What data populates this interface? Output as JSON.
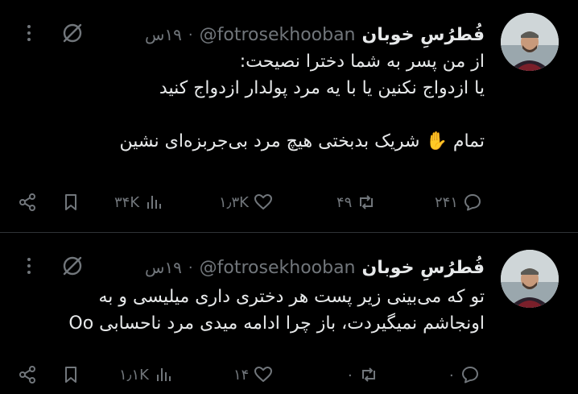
{
  "tweets": [
    {
      "author_name": "فُطرُسِ خوبان",
      "handle": "@fotrosekhooban",
      "separator": "·",
      "time": "۱۹س",
      "lines": [
        "از من پسر به شما دخترا نصیحت:",
        "یا ازدواج نکنین یا با یه مرد پولدار ازدواج کنید",
        "",
        "تمام ✋ شریک بدبختی هیچ مرد بی‌جربزه‌ای نشین"
      ],
      "replies": "۲۴۱",
      "reposts": "۴۹",
      "likes": "۱٫۳K",
      "views": "۳۴K"
    },
    {
      "author_name": "فُطرُسِ خوبان",
      "handle": "@fotrosekhooban",
      "separator": "·",
      "time": "۱۹س",
      "lines": [
        "تو که می‌بینی زیر پست هر دختری داری میلیسی و به",
        "اونجاشم نمیگیردت، باز چرا ادامه میدی مرد ناحسابی Oo"
      ],
      "replies": "۰",
      "reposts": "۰",
      "likes": "۱۴",
      "views": "۱٫۱K"
    }
  ],
  "icons": {
    "reply": "reply-icon",
    "repost": "repost-icon",
    "like": "heart-icon",
    "views": "views-chart-icon",
    "bookmark": "bookmark-icon",
    "share": "share-icon",
    "grok": "grok-icon",
    "more": "more-vertical-icon"
  },
  "colors": {
    "background": "#000000",
    "text": "#e7e9ea",
    "muted": "#71767b",
    "divider": "#2f3336"
  }
}
